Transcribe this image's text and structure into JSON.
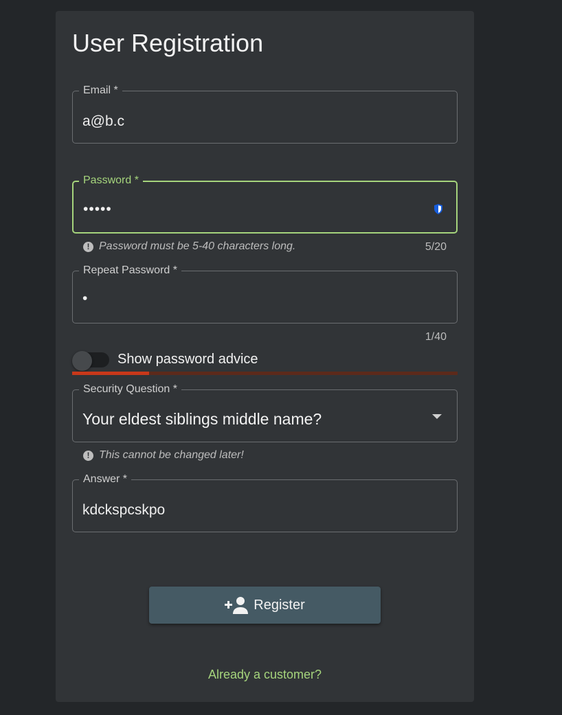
{
  "form": {
    "title": "User Registration",
    "email": {
      "label": "Email *",
      "value": "a@b.c"
    },
    "password": {
      "label": "Password *",
      "value": "•••••",
      "hint": "Password must be 5-40 characters long.",
      "counter": "5/20"
    },
    "repeat_password": {
      "label": "Repeat Password *",
      "value": "•",
      "counter": "1/40"
    },
    "advice_toggle": {
      "label": "Show password advice",
      "on": false
    },
    "strength_meter": {
      "fraction": 0.2,
      "color": "#c8381a",
      "track_color": "#5c2a1b"
    },
    "security_question": {
      "label": "Security Question *",
      "selected": "Your eldest siblings middle name?",
      "hint": "This cannot be changed later!"
    },
    "answer": {
      "label": "Answer *",
      "value": "kdckspcskpo"
    },
    "register_button": {
      "label": "Register",
      "icon": "person-add-icon"
    },
    "customer_link": "Already a customer?"
  },
  "colors": {
    "accent": "#a5d47c",
    "button": "#455a64",
    "background": "#232629",
    "card": "#313437"
  }
}
